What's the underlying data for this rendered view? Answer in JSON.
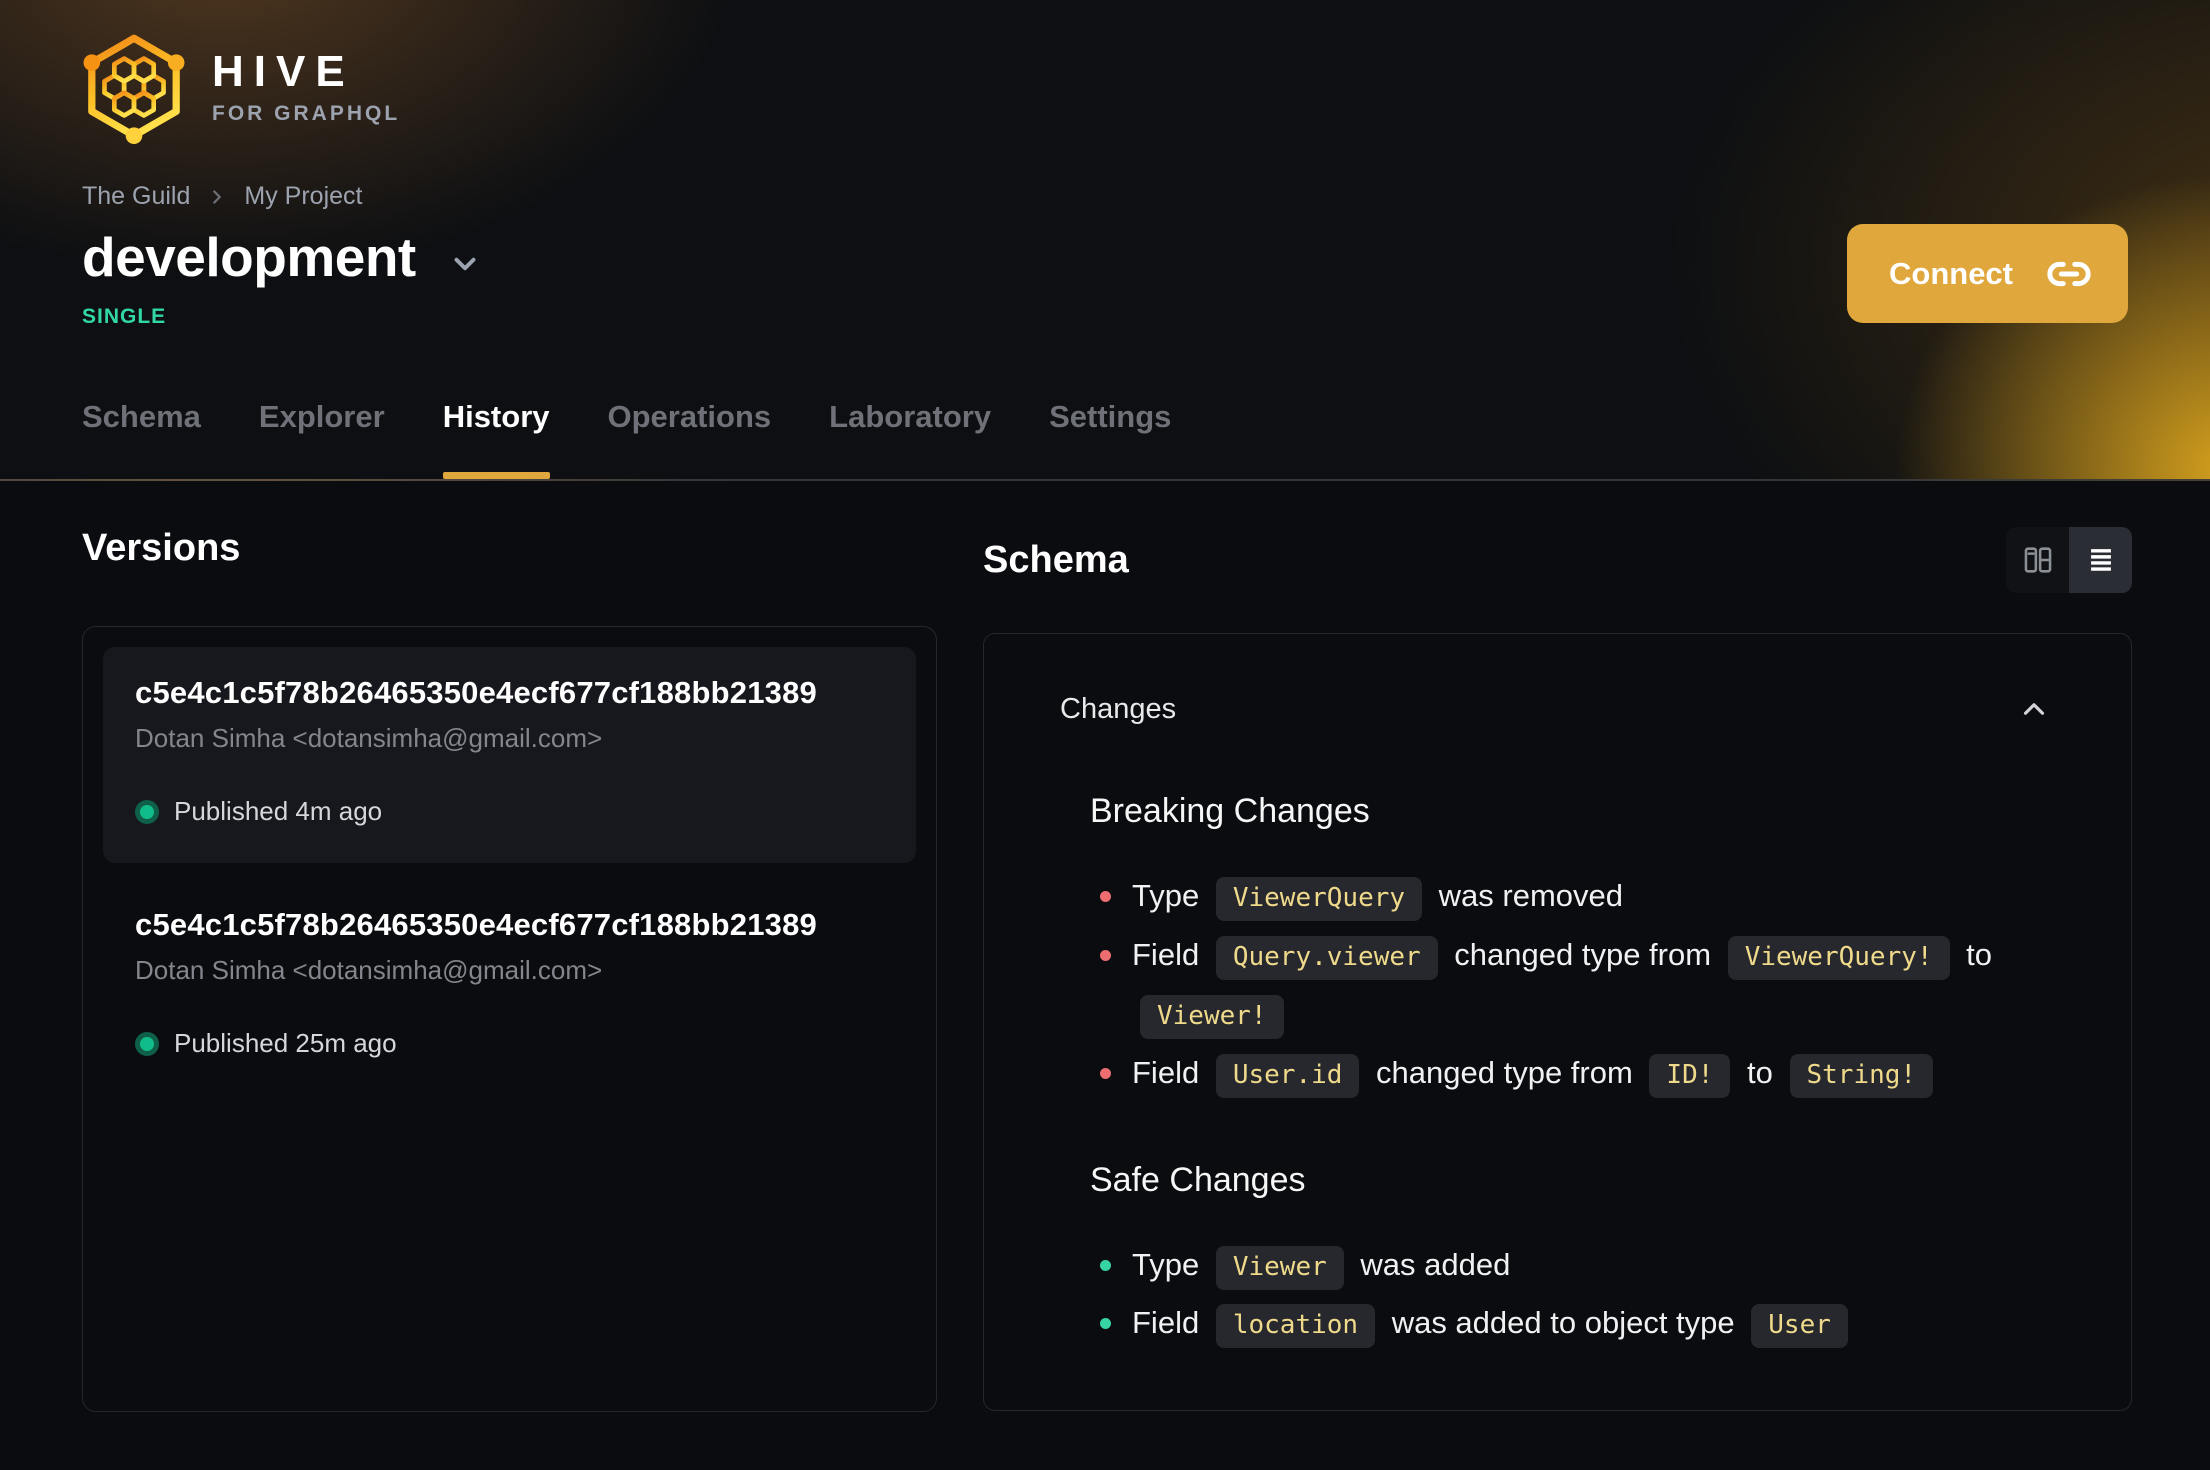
{
  "brand": {
    "name": "HIVE",
    "tagline": "FOR GRAPHQL"
  },
  "breadcrumb": {
    "items": [
      "The Guild",
      "My Project"
    ]
  },
  "target": {
    "name": "development",
    "badge": "SINGLE"
  },
  "connect": {
    "label": "Connect"
  },
  "tabs": [
    {
      "label": "Schema",
      "active": false
    },
    {
      "label": "Explorer",
      "active": false
    },
    {
      "label": "History",
      "active": true
    },
    {
      "label": "Operations",
      "active": false
    },
    {
      "label": "Laboratory",
      "active": false
    },
    {
      "label": "Settings",
      "active": false
    }
  ],
  "versions": {
    "title": "Versions",
    "items": [
      {
        "hash": "c5e4c1c5f78b26465350e4ecf677cf188bb21389",
        "author": "Dotan Simha <dotansimha@gmail.com>",
        "status": "Published 4m ago",
        "highlighted": true
      },
      {
        "hash": "c5e4c1c5f78b26465350e4ecf677cf188bb21389",
        "author": "Dotan Simha <dotansimha@gmail.com>",
        "status": "Published 25m ago",
        "highlighted": false
      }
    ]
  },
  "schema": {
    "title": "Schema",
    "changes_title": "Changes",
    "sections": [
      {
        "title": "Breaking Changes",
        "kind": "breaking",
        "items": [
          [
            {
              "t": "text",
              "v": "Type"
            },
            {
              "t": "code",
              "v": "ViewerQuery"
            },
            {
              "t": "text",
              "v": "was removed"
            }
          ],
          [
            {
              "t": "text",
              "v": "Field"
            },
            {
              "t": "code",
              "v": "Query.viewer"
            },
            {
              "t": "text",
              "v": "changed type from"
            },
            {
              "t": "code",
              "v": "ViewerQuery!"
            },
            {
              "t": "text",
              "v": "to"
            },
            {
              "t": "code",
              "v": "Viewer!"
            }
          ],
          [
            {
              "t": "text",
              "v": "Field"
            },
            {
              "t": "code",
              "v": "User.id"
            },
            {
              "t": "text",
              "v": "changed type from"
            },
            {
              "t": "code",
              "v": "ID!"
            },
            {
              "t": "text",
              "v": "to"
            },
            {
              "t": "code",
              "v": "String!"
            }
          ]
        ]
      },
      {
        "title": "Safe Changes",
        "kind": "safe",
        "items": [
          [
            {
              "t": "text",
              "v": "Type"
            },
            {
              "t": "code",
              "v": "Viewer"
            },
            {
              "t": "text",
              "v": "was added"
            }
          ],
          [
            {
              "t": "text",
              "v": "Field"
            },
            {
              "t": "code",
              "v": "location"
            },
            {
              "t": "text",
              "v": "was added to object type"
            },
            {
              "t": "code",
              "v": "User"
            }
          ]
        ]
      }
    ]
  },
  "colors": {
    "bg": "#0a0c0f",
    "accent": "#dfa73c",
    "badge_green": "#31d8a4",
    "panel_border": "#24272c",
    "code_bg": "#26282d",
    "code_text": "#efd98b",
    "bullet_breaking": "#ee6d70",
    "bullet_safe": "#38d3a2",
    "published_dot": "#10bd8a"
  }
}
